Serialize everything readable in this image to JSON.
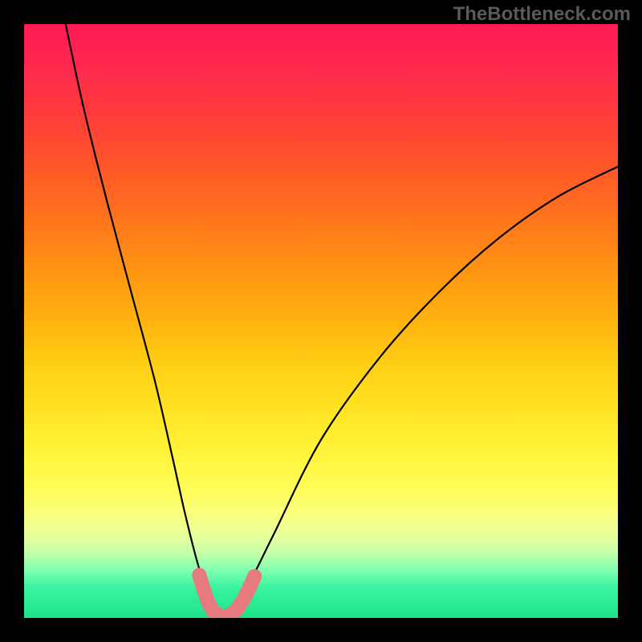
{
  "watermark": "TheBottleneck.com",
  "chart_data": {
    "type": "line",
    "title": "",
    "xlabel": "",
    "ylabel": "",
    "xlim": [
      0,
      100
    ],
    "ylim": [
      0,
      100
    ],
    "background_gradient": {
      "top_color": "#ff1a55",
      "mid_color": "#ffe626",
      "bottom_color": "#1fe388"
    },
    "series": [
      {
        "name": "bottleneck-curve",
        "color": "#000000",
        "x": [
          7,
          10,
          14,
          18,
          22,
          25,
          27,
          29,
          30.5,
          32,
          33.5,
          35,
          38,
          42,
          50,
          60,
          70,
          80,
          90,
          100
        ],
        "values": [
          100,
          86,
          70,
          55,
          40,
          27,
          18,
          10,
          5,
          1,
          0,
          1,
          6,
          14,
          30,
          44,
          55,
          64,
          71,
          76
        ]
      }
    ],
    "markers": {
      "name": "highlight-segment",
      "color": "#e77a7f",
      "x": [
        29.5,
        30.3,
        31.0,
        31.8,
        32.6,
        33.5,
        34.6,
        35.8,
        37.0,
        38.0,
        38.8
      ],
      "values": [
        7.2,
        4.6,
        2.6,
        1.2,
        0.5,
        0.2,
        0.4,
        1.4,
        3.2,
        5.2,
        7.0
      ]
    }
  }
}
